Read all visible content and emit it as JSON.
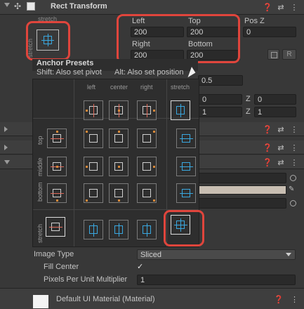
{
  "header": {
    "title": "Rect Transform"
  },
  "anchor_widget": {
    "label": "stretch",
    "side_label": "stretch"
  },
  "fields": {
    "left": {
      "label": "Left",
      "value": "200"
    },
    "top": {
      "label": "Top",
      "value": "200"
    },
    "posz": {
      "label": "Pos Z",
      "value": "0"
    },
    "right": {
      "label": "Right",
      "value": "200"
    },
    "bottom": {
      "label": "Bottom",
      "value": "200"
    }
  },
  "buttons": {
    "r_label": "R"
  },
  "presets": {
    "title": "Anchor Presets",
    "hint_left": "Shift: Also set pivot",
    "hint_right": "Alt: Also set position",
    "columns": [
      "left",
      "center",
      "right",
      "stretch"
    ],
    "rows": [
      "top",
      "middle",
      "bottom",
      "stretch"
    ]
  },
  "pivot": {
    "y_value": "0.5"
  },
  "rotation": {
    "x": "0",
    "z_label": "Z",
    "z": "0"
  },
  "scale": {
    "x": "1",
    "z_label": "Z",
    "z": "1"
  },
  "image": {
    "type_label": "Image Type",
    "type_value": "Sliced",
    "fill_center_label": "Fill Center",
    "fill_center_check": "✓",
    "ppu_label": "Pixels Per Unit Multiplier",
    "ppu_value": "1"
  },
  "material": {
    "label": "Default UI Material (Material)"
  },
  "colors": {
    "highlight": "#e0453c",
    "accent": "#3aa8e0"
  },
  "icons": [
    "move-icon",
    "help-icon",
    "settings-icon",
    "more-icon",
    "cursor-icon"
  ]
}
